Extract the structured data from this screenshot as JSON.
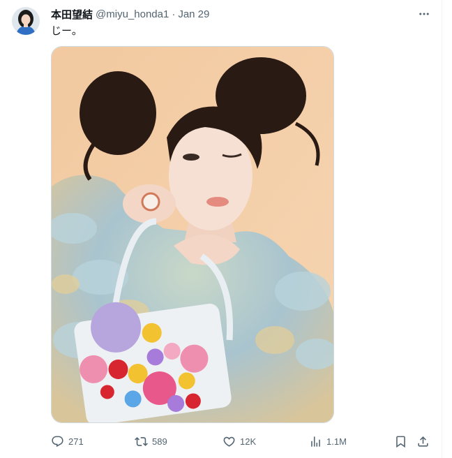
{
  "tweet": {
    "author_name": "本田望結",
    "author_handle": "@miyu_honda1",
    "separator": "·",
    "date": "Jan 29",
    "text": "じー。",
    "media_icon": "photo",
    "more_icon": "more-horizontal-icon"
  },
  "actions": {
    "replies": "271",
    "retweets": "589",
    "likes": "12K",
    "views": "1.1M",
    "bookmark_icon": "bookmark-icon",
    "share_icon": "share-icon"
  },
  "colors": {
    "text": "#0f1419",
    "secondary": "#536471",
    "border": "#cfd9de"
  }
}
